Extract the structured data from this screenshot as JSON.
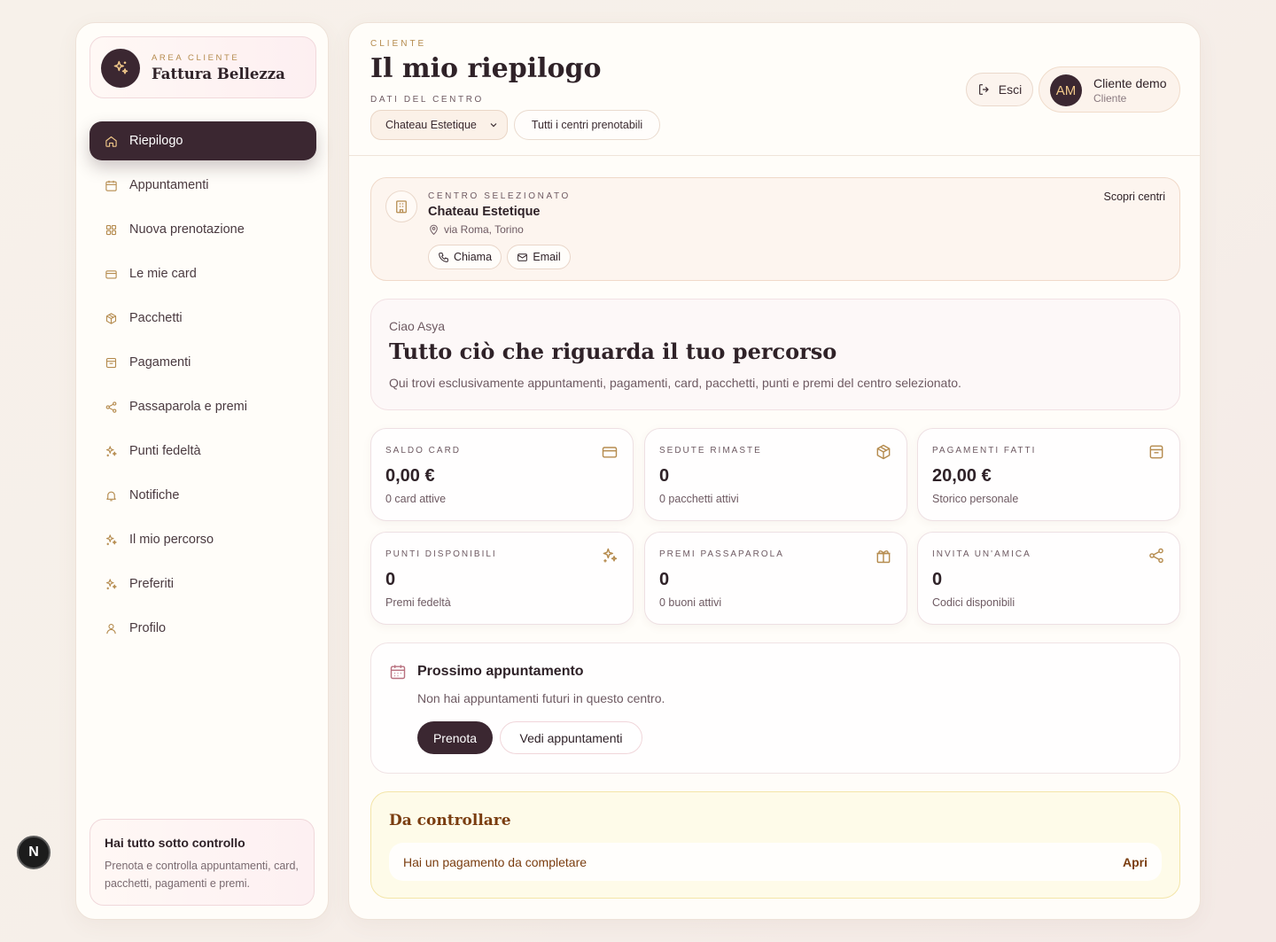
{
  "brand": {
    "kicker": "AREA CLIENTE",
    "name": "Fattura Bellezza"
  },
  "nav": [
    {
      "label": "Riepilogo",
      "icon": "home-icon",
      "active": true
    },
    {
      "label": "Appuntamenti",
      "icon": "calendar-icon"
    },
    {
      "label": "Nuova prenotazione",
      "icon": "grid-icon"
    },
    {
      "label": "Le mie card",
      "icon": "card-icon"
    },
    {
      "label": "Pacchetti",
      "icon": "package-icon"
    },
    {
      "label": "Pagamenti",
      "icon": "receipt-icon"
    },
    {
      "label": "Passaparola e premi",
      "icon": "share-icon"
    },
    {
      "label": "Punti fedeltà",
      "icon": "sparkles-icon"
    },
    {
      "label": "Notifiche",
      "icon": "bell-icon"
    },
    {
      "label": "Il mio percorso",
      "icon": "sparkles-icon"
    },
    {
      "label": "Preferiti",
      "icon": "sparkles-icon"
    },
    {
      "label": "Profilo",
      "icon": "user-icon"
    }
  ],
  "sidebar_footer": {
    "title": "Hai tutto sotto controllo",
    "text": "Prenota e controlla appuntamenti, card, pacchetti, pagamenti e premi."
  },
  "n_badge": "N",
  "header": {
    "kicker": "CLIENTE",
    "title": "Il mio riepilogo",
    "centro_label": "DATI DEL CENTRO",
    "centro_select": "Chateau Estetique",
    "all_centri": "Tutti i centri prenotabili",
    "logout": "Esci",
    "user": {
      "initials": "AM",
      "name": "Cliente demo",
      "role": "Cliente"
    }
  },
  "centro": {
    "kicker": "CENTRO SELEZIONATO",
    "name": "Chateau Estetique",
    "address": "via Roma, Torino",
    "call": "Chiama",
    "email": "Email",
    "discover": "Scopri centri"
  },
  "welcome": {
    "hello": "Ciao Asya",
    "title": "Tutto ciò che riguarda il tuo percorso",
    "desc": "Qui trovi esclusivamente appuntamenti, pagamenti, card, pacchetti, punti e premi del centro selezionato."
  },
  "stats": [
    {
      "label": "SALDO CARD",
      "value": "0,00 €",
      "sub": "0 card attive",
      "icon": "card-icon"
    },
    {
      "label": "SEDUTE RIMASTE",
      "value": "0",
      "sub": "0 pacchetti attivi",
      "icon": "package-icon"
    },
    {
      "label": "PAGAMENTI FATTI",
      "value": "20,00 €",
      "sub": "Storico personale",
      "icon": "receipt-icon"
    },
    {
      "label": "PUNTI DISPONIBILI",
      "value": "0",
      "sub": "Premi fedeltà",
      "icon": "sparkles-icon"
    },
    {
      "label": "PREMI PASSAPAROLA",
      "value": "0",
      "sub": "0 buoni attivi",
      "icon": "gift-icon"
    },
    {
      "label": "INVITA UN'AMICA",
      "value": "0",
      "sub": "Codici disponibili",
      "icon": "share-icon"
    }
  ],
  "appointment": {
    "title": "Prossimo appuntamento",
    "desc": "Non hai appuntamenti futuri in questo centro.",
    "book": "Prenota",
    "view": "Vedi appuntamenti"
  },
  "check": {
    "title": "Da controllare",
    "item": "Hai un pagamento da completare",
    "action": "Apri"
  },
  "colors": {
    "primary": "#3b2731",
    "accent": "#b58b4e",
    "warning_text": "#7a3d10"
  }
}
